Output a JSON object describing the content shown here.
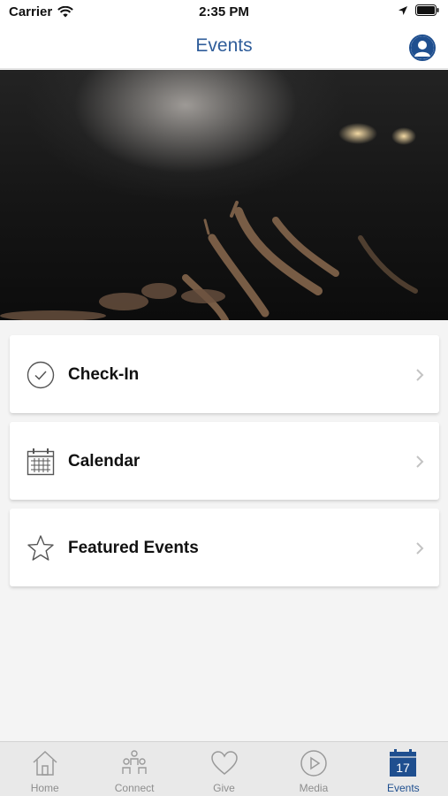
{
  "status_bar": {
    "carrier": "Carrier",
    "time": "2:35 PM"
  },
  "nav": {
    "title": "Events"
  },
  "menu": [
    {
      "label": "Check-In",
      "icon": "checkmark-circle-icon"
    },
    {
      "label": "Calendar",
      "icon": "calendar-icon"
    },
    {
      "label": "Featured Events",
      "icon": "star-icon"
    }
  ],
  "tabs": [
    {
      "label": "Home",
      "icon": "home-icon",
      "active": false
    },
    {
      "label": "Connect",
      "icon": "people-icon",
      "active": false
    },
    {
      "label": "Give",
      "icon": "heart-icon",
      "active": false
    },
    {
      "label": "Media",
      "icon": "play-icon",
      "active": false
    },
    {
      "label": "Events",
      "icon": "calendar-17-icon",
      "active": true,
      "badge": "17"
    }
  ],
  "colors": {
    "accent": "#1f4f8f",
    "title": "#2f5d9a",
    "inactive_tab": "#8e8e8e",
    "background": "#f4f4f4"
  }
}
